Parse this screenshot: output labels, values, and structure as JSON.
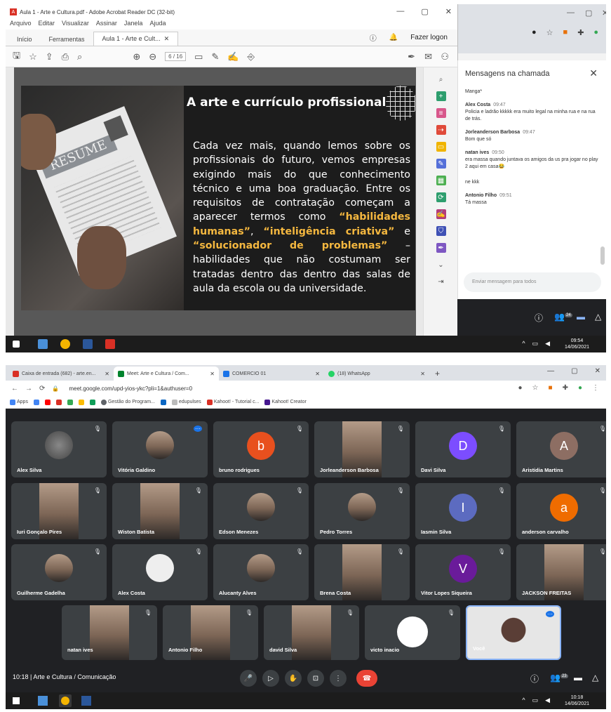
{
  "top": {
    "acrobat": {
      "title": "Aula 1 - Arte e Cultura.pdf - Adobe Acrobat Reader DC (32-bit)",
      "menu": [
        "Arquivo",
        "Editar",
        "Visualizar",
        "Assinar",
        "Janela",
        "Ajuda"
      ],
      "tabs": [
        "Início",
        "Ferramentas",
        "Aula 1 - Arte e Cult..."
      ],
      "signin": "Fazer logon",
      "page_field": "6",
      "page_total": "/ 16",
      "slide": {
        "heading": "A arte e currículo profissional",
        "resume_label": "RESUME",
        "text_parts": [
          "Cada vez mais, quando lemos sobre os profissionais do futuro, vemos empresas exigindo mais do que conhecimento técnico e uma boa graduação. Entre os requisitos de contratação começam a aparecer termos como ",
          "“habilidades humanas”",
          ", ",
          "“inteligência criativa”",
          " e ",
          "“solucionador de problemas”",
          " – habilidades que não costumam ser tratadas dentro das dentro das salas de aula da escola ou da universidade."
        ]
      }
    },
    "chat": {
      "title": "Mensagens na chamada",
      "first_partial": "Manga*",
      "messages": [
        {
          "who": "Alex Costa",
          "time": "09:47",
          "text": "Policia e ladrão kkkkk era muito legal na minha rua e na rua de trás."
        },
        {
          "who": "Jorleanderson Barbosa",
          "time": "09:47",
          "text": "Bom que só"
        },
        {
          "who": "natan ives",
          "time": "09:50",
          "text": "era massa quando juntava os amigos da us pra jogar no play 2 aqui em casa😂"
        },
        {
          "who": "",
          "time": "",
          "text": "ne kkk"
        },
        {
          "who": "Antonio Filho",
          "time": "09:51",
          "text": "Tá massa"
        }
      ],
      "input_placeholder": "Enviar mensagem para todos",
      "participants_count": "24"
    },
    "taskbar": {
      "time": "09:54",
      "date": "14/06/2021"
    }
  },
  "bottom": {
    "tabs": [
      {
        "label": "Caixa de entrada (682) - arte.en...",
        "color": "#d93025"
      },
      {
        "label": "Meet: Arte e Cultura / Com...",
        "color": "#00832d"
      },
      {
        "label": "COMERCIO 01",
        "color": "#1a73e8"
      },
      {
        "label": "(18) WhatsApp",
        "color": "#25d366"
      }
    ],
    "url": "meet.google.com/upd-yios-ykc?pli=1&authuser=0",
    "bookmarks": [
      "Apps",
      "Gestão do Program...",
      "edupulses",
      "Kahoot! - Tutorial c...",
      "Kahoot! Creator"
    ],
    "participants": [
      {
        "name": "Alex Silva",
        "initial": "",
        "color": ""
      },
      {
        "name": "Vitória Galdino",
        "initial": "",
        "color": ""
      },
      {
        "name": "bruno rodrigues",
        "initial": "b",
        "color": "#e8501e"
      },
      {
        "name": "Jorleanderson Barbosa",
        "initial": "",
        "color": ""
      },
      {
        "name": "Davi Silva",
        "initial": "D",
        "color": "#7c4dff"
      },
      {
        "name": "Aristidia Martins",
        "initial": "A",
        "color": "#8d6e63"
      },
      {
        "name": "Iuri Gonçalo Pires",
        "initial": "",
        "color": ""
      },
      {
        "name": "Wiston Batista",
        "initial": "",
        "color": ""
      },
      {
        "name": "Edson Menezes",
        "initial": "",
        "color": ""
      },
      {
        "name": "Pedro Torres",
        "initial": "",
        "color": ""
      },
      {
        "name": "Iasmin Silva",
        "initial": "I",
        "color": "#5c6bc0"
      },
      {
        "name": "anderson carvalho",
        "initial": "a",
        "color": "#ef6c00"
      },
      {
        "name": "Guilherme Gadelha",
        "initial": "",
        "color": ""
      },
      {
        "name": "Alex Costa",
        "initial": "",
        "color": ""
      },
      {
        "name": "Alucanty Alves",
        "initial": "",
        "color": ""
      },
      {
        "name": "Brena Costa",
        "initial": "",
        "color": ""
      },
      {
        "name": "Vitor Lopes Siqueira",
        "initial": "V",
        "color": "#6a1b9a"
      },
      {
        "name": "JACKSON FREITAS",
        "initial": "",
        "color": ""
      },
      {
        "name": "natan ives",
        "initial": "",
        "color": ""
      },
      {
        "name": "Antonio Filho",
        "initial": "",
        "color": ""
      },
      {
        "name": "david Silva",
        "initial": "",
        "color": ""
      },
      {
        "name": "victo inacio",
        "initial": "",
        "color": ""
      },
      {
        "name": "Você",
        "initial": "",
        "color": ""
      }
    ],
    "meeting_label": "10:18  |  Arte e Cultura / Comunicação",
    "participants_count": "23",
    "taskbar": {
      "time": "10:18",
      "date": "14/06/2021"
    }
  }
}
